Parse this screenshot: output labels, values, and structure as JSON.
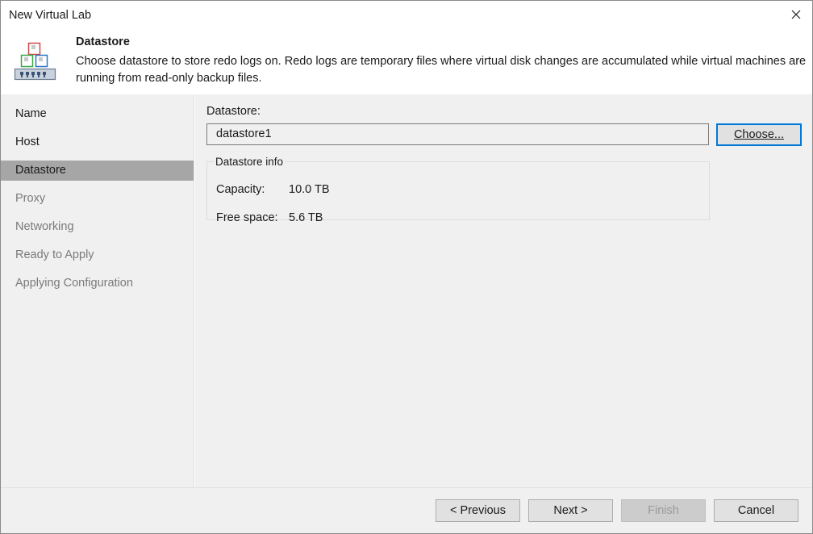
{
  "window": {
    "title": "New Virtual Lab"
  },
  "header": {
    "title": "Datastore",
    "description": "Choose datastore to store redo logs on. Redo logs are temporary files where virtual disk changes are accumulated while virtual machines are running from read-only backup files.",
    "icon": "virtual-lab-icon"
  },
  "sidebar": {
    "items": [
      {
        "label": "Name",
        "state": "enabled"
      },
      {
        "label": "Host",
        "state": "enabled"
      },
      {
        "label": "Datastore",
        "state": "active"
      },
      {
        "label": "Proxy",
        "state": "disabled"
      },
      {
        "label": "Networking",
        "state": "disabled"
      },
      {
        "label": "Ready to Apply",
        "state": "disabled"
      },
      {
        "label": "Applying Configuration",
        "state": "disabled"
      }
    ]
  },
  "main": {
    "datastore_label": "Datastore:",
    "datastore_value": "datastore1",
    "choose_button": "Choose...",
    "info_group_label": "Datastore info",
    "capacity_label": "Capacity:",
    "capacity_value": "10.0 TB",
    "free_space_label": "Free space:",
    "free_space_value": "5.6 TB"
  },
  "footer": {
    "previous_button": "< Previous",
    "next_button": "Next >",
    "finish_button": "Finish",
    "cancel_button": "Cancel"
  },
  "colors": {
    "selected_item_bg": "#a6a6a6",
    "focus_border": "#0078d7",
    "panel_bg": "#f0f0f0"
  }
}
